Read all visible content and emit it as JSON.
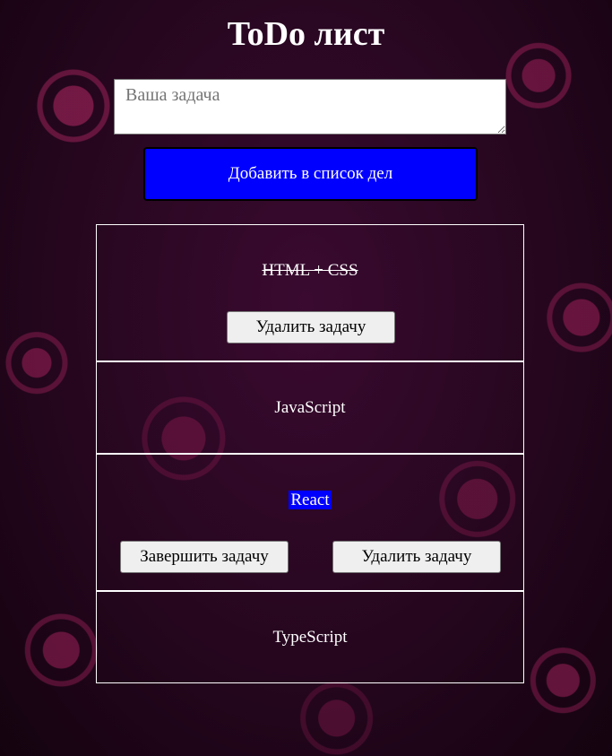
{
  "header": {
    "title": "ToDo лист"
  },
  "form": {
    "placeholder": "Ваша задача",
    "value": "",
    "add_button_label": "Добавить в список дел",
    "accent_color": "#0000ff"
  },
  "tasks": [
    {
      "text": "HTML + CSS",
      "completed": true,
      "buttons": [
        "Удалить задачу"
      ]
    },
    {
      "text": "JavaScript",
      "completed": false,
      "buttons": []
    },
    {
      "text": "React",
      "completed": false,
      "highlighted": true,
      "buttons": [
        "Завершить задачу",
        "Удалить задачу"
      ]
    },
    {
      "text": "TypeScript",
      "completed": false,
      "buttons": []
    }
  ]
}
